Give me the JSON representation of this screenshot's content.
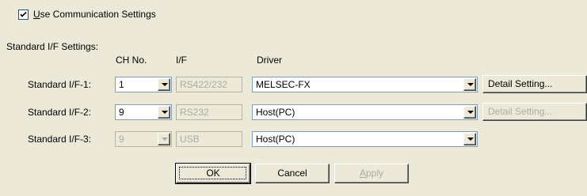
{
  "use_comm": {
    "checked": true,
    "label_mnemonic": "U",
    "label_rest": "se Communication Settings"
  },
  "section_title": "Standard I/F Settings:",
  "columns": {
    "ch_no": "CH No.",
    "if": "I/F",
    "driver": "Driver"
  },
  "rows": [
    {
      "label": "Standard I/F-1:",
      "ch": "1",
      "if": "RS422/232",
      "driver": "MELSEC-FX",
      "detail": "Detail Setting..."
    },
    {
      "label": "Standard I/F-2:",
      "ch": "9",
      "if": "RS232",
      "driver": "Host(PC)",
      "detail": "Detail Setting..."
    },
    {
      "label": "Standard I/F-3:",
      "ch": "9",
      "if": "USB",
      "driver": "Host(PC)"
    }
  ],
  "buttons": {
    "ok": "OK",
    "cancel": "Cancel",
    "apply_mnemonic": "A",
    "apply_rest": "pply"
  }
}
